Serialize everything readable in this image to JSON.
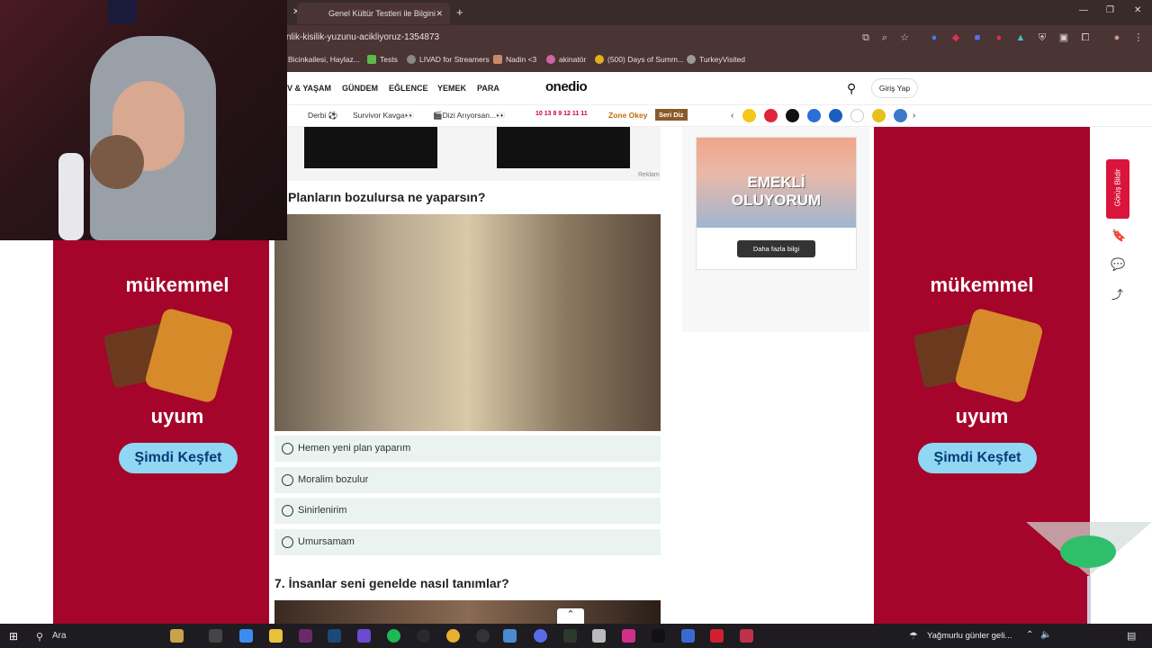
{
  "browser": {
    "tab_title": "Genel Kültür Testleri ile Bilgini",
    "url": "nlik-kisilik-yuzunu-acikliyoruz-1354873",
    "bookmarks": [
      "Bicinkailesi, Haylaz...",
      "Tests",
      "LIVAD for Streamers",
      "Nadin <3",
      "akinatör",
      "(500) Days of Summ...",
      "TurkeyVisited"
    ]
  },
  "site": {
    "nav": [
      "V & YAŞAM",
      "GÜNDEM",
      "EĞLENCE",
      "YEMEK",
      "PARA"
    ],
    "logo": "onedio",
    "login": "Giriş Yap",
    "subnav": {
      "derbi": "Derbi ⚽",
      "survivor": "Survivor Kavga👀",
      "dizi": "🎬Dizi Arıyorsan...👀",
      "numbers": "10 13 8 9 12 11 11",
      "zone": "Zone Okey",
      "seri": "Seri Diz"
    }
  },
  "ad": {
    "reklam": "Reklam",
    "headline": "mükemmel",
    "tagline": "uyum",
    "cta": "Şimdi Keşfet",
    "side_video_title": "EMEKLİ OLUYORUM",
    "side_cta": "Daha fazla bilgi",
    "feedback": "Görüş Bildir"
  },
  "quiz": {
    "q6": "Planların bozulursa ne yaparsın?",
    "options": [
      "Hemen yeni plan yaparım",
      "Moralim bozulur",
      "Sinirlenirim",
      "Umursamam"
    ],
    "q7": "7. İnsanlar seni genelde nasıl tanımlar?"
  },
  "taskbar": {
    "search": "Ara",
    "weather": "Yağmurlu günler geli..."
  },
  "colors": {
    "ad_red": "#a5042b",
    "option_bg": "#eaf3f0",
    "chrome": "#4a3434"
  }
}
